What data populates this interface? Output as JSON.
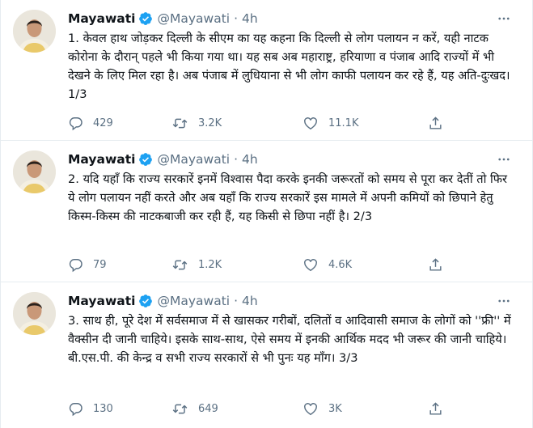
{
  "colors": {
    "text": "#0f1419",
    "muted": "#5b7083",
    "verified": "#1da1f2",
    "border": "#e6ecf0"
  },
  "icons": [
    "verified-badge-icon",
    "more-icon",
    "reply-icon",
    "retweet-icon",
    "like-icon",
    "share-icon"
  ],
  "tweets": [
    {
      "name": "Mayawati",
      "handle": "@Mayawati",
      "separator": "·",
      "time": "4h",
      "text": "1. केवल हाथ जोड़कर दिल्ली के सीएम का यह कहना कि दिल्ली से लोग पलायन न करें, यही नाटक कोरोना के दौरान् पहले भी किया गया था। यह सब अब महाराष्ट्र, हरियाणा व पंजाब आदि राज्यों में भी देखने के लिए मिल रहा है। अब पंजाब में लुधियाना से भी लोग काफी पलायन कर रहे हैं, यह अति-दुःखद। 1/3",
      "replies": "429",
      "retweets": "3.2K",
      "likes": "11.1K"
    },
    {
      "name": "Mayawati",
      "handle": "@Mayawati",
      "separator": "·",
      "time": "4h",
      "text": "2. यदि यहाँ कि राज्य सरकारें इनमें विश्वास पैदा करके इनकी जरूरतों को समय से पूरा कर देतीं तो फिर ये लोग पलायन नहीं करते और अब यहाँ कि राज्य सरकारें इस मामले में अपनी कमियों को छिपाने हेतु किस्म-किस्म की नाटकबाजी कर रही हैं, यह किसी से छिपा नहीं है। 2/3",
      "replies": "79",
      "retweets": "1.2K",
      "likes": "4.6K"
    },
    {
      "name": "Mayawati",
      "handle": "@Mayawati",
      "separator": "·",
      "time": "4h",
      "text": "3. साथ ही, पूरे देश में सर्वसमाज में से खासकर गरीबों, दलितों व आदिवासी समाज के लोगों को ''फ्री'' में वैक्सीन दी जानी चाहिये। इसके साथ-साथ, ऐसे समय में इनकी आर्थिक मदद भी जरूर की जानी चाहिये। बी.एस.पी. की केन्द्र व सभी राज्य सरकारों से भी पुनः यह माँग। 3/3",
      "replies": "130",
      "retweets": "649",
      "likes": "3K"
    }
  ]
}
